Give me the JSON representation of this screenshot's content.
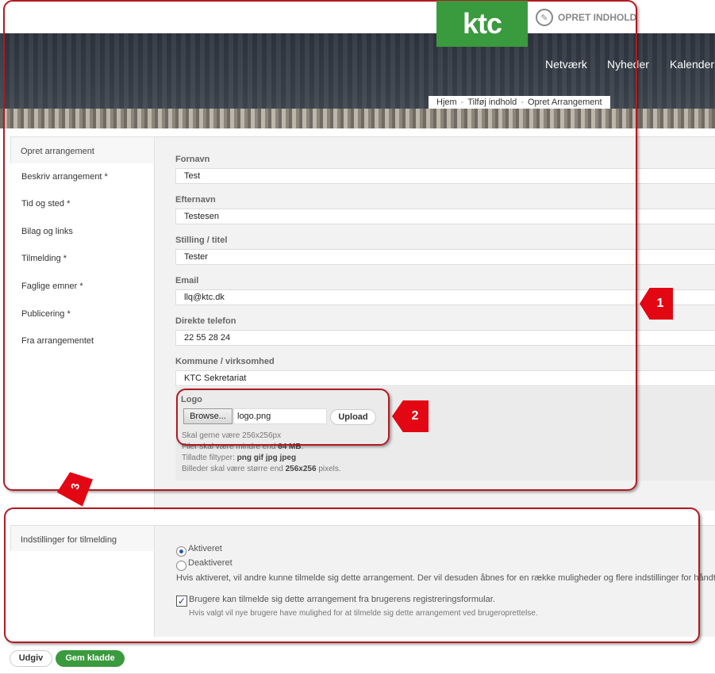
{
  "header": {
    "logo_text": "ktc",
    "create_content_label": "OPRET INDHOLD",
    "nav": [
      "Netværk",
      "Nyheder",
      "Kalender"
    ],
    "breadcrumb": [
      "Hjem",
      "Tilføj indhold",
      "Opret Arrangement"
    ]
  },
  "section1": {
    "tab_label": "Opret arrangement",
    "sidebar": [
      "Beskriv arrangement *",
      "Tid og sted *",
      "Bilag og links",
      "Tilmelding *",
      "Faglige emner *",
      "Publicering *",
      "Fra arrangementet"
    ],
    "fields": [
      {
        "label": "Fornavn",
        "value": "Test"
      },
      {
        "label": "Efternavn",
        "value": "Testesen"
      },
      {
        "label": "Stilling / titel",
        "value": "Tester"
      },
      {
        "label": "Email",
        "value": "llq@ktc.dk"
      },
      {
        "label": "Direkte telefon",
        "value": "22 55 28 24"
      },
      {
        "label": "Kommune / virksomhed",
        "value": "KTC Sekretariat"
      }
    ],
    "logo": {
      "label": "Logo",
      "browse_label": "Browse...",
      "file_name": "logo.png",
      "upload_label": "Upload",
      "hint_size": "Skal gerne være 256x256px",
      "hint_max_prefix": "Filer skal være mindre end ",
      "hint_max_value": "64 MB",
      "hint_max_suffix": ".",
      "hint_types_prefix": "Tilladte filtyper: ",
      "hint_types_value": "png gif jpg jpeg",
      "hint_dims_prefix": "Billeder skal være større end ",
      "hint_dims_value": "256x256",
      "hint_dims_suffix": " pixels."
    }
  },
  "section2": {
    "tab_label": "Indstillinger for tilmelding",
    "radio_on": "Aktiveret",
    "radio_off": "Deaktiveret",
    "description": "Hvis aktiveret, vil andre kunne tilmelde sig dette arrangement. Der vil desuden åbnes for en række muligheder og flere indstillinger for håndtering",
    "checkbox_label": "Brugere kan tilmelde sig dette arrangement fra brugerens registreringsformular.",
    "checkbox_help": "Hvis valgt vil nye brugere have mulighed for at tilmelde sig dette arrangement ved brugeroprettelse."
  },
  "actions": {
    "publish": "Udgiv",
    "save_draft": "Gem kladde"
  },
  "annotations": [
    "1",
    "2",
    "3"
  ],
  "colors": {
    "brand_green": "#3a9a3e",
    "annotation_red": "#e30613",
    "annotation_border": "#b11a22"
  }
}
